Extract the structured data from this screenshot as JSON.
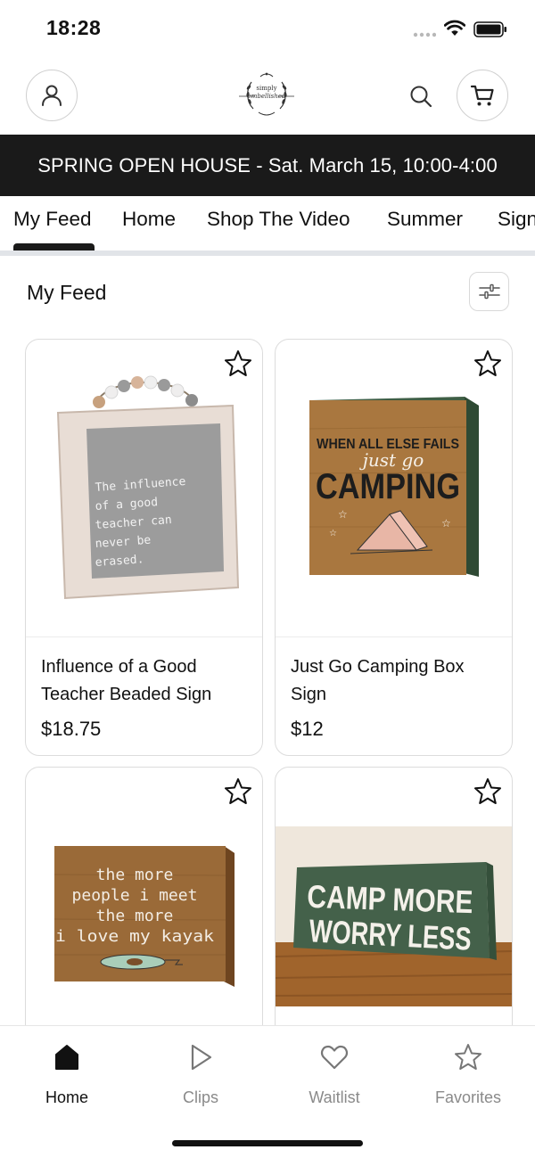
{
  "status_bar": {
    "time": "18:28"
  },
  "header": {
    "logo_line1": "simply",
    "logo_line2": "embellished"
  },
  "banner": {
    "text": "SPRING OPEN HOUSE - Sat. March 15, 10:00-4:00"
  },
  "tabs": [
    {
      "label": "My Feed",
      "active": true
    },
    {
      "label": "Home"
    },
    {
      "label": "Shop The Video"
    },
    {
      "label": "Summer"
    },
    {
      "label": "Signs"
    }
  ],
  "feed": {
    "title": "My Feed",
    "products": [
      {
        "name": "Influence of a Good Teacher Beaded Sign",
        "price": "$18.75",
        "sign_text": [
          "The influence",
          "of a good",
          "teacher can",
          "never be",
          "erased."
        ]
      },
      {
        "name": "Just Go Camping Box Sign",
        "price": "$12",
        "sign_text": [
          "WHEN ALL ELSE FAILS",
          "just go",
          "CAMPING"
        ]
      },
      {
        "name": "",
        "price": "",
        "sign_text": [
          "the more",
          "people i meet",
          "the more",
          "i love my kayak"
        ]
      },
      {
        "name": "",
        "price": "",
        "sign_text": [
          "CAMP MORE",
          "WORRY LESS"
        ]
      }
    ]
  },
  "bottom_nav": [
    {
      "label": "Home",
      "icon": "home-icon",
      "active": true
    },
    {
      "label": "Clips",
      "icon": "play-icon"
    },
    {
      "label": "Waitlist",
      "icon": "heart-icon"
    },
    {
      "label": "Favorites",
      "icon": "star-icon"
    }
  ],
  "colors": {
    "banner_bg": "#1a1a1a",
    "text": "#111111",
    "muted": "#8a8a8a",
    "border": "#dcdcdc"
  }
}
